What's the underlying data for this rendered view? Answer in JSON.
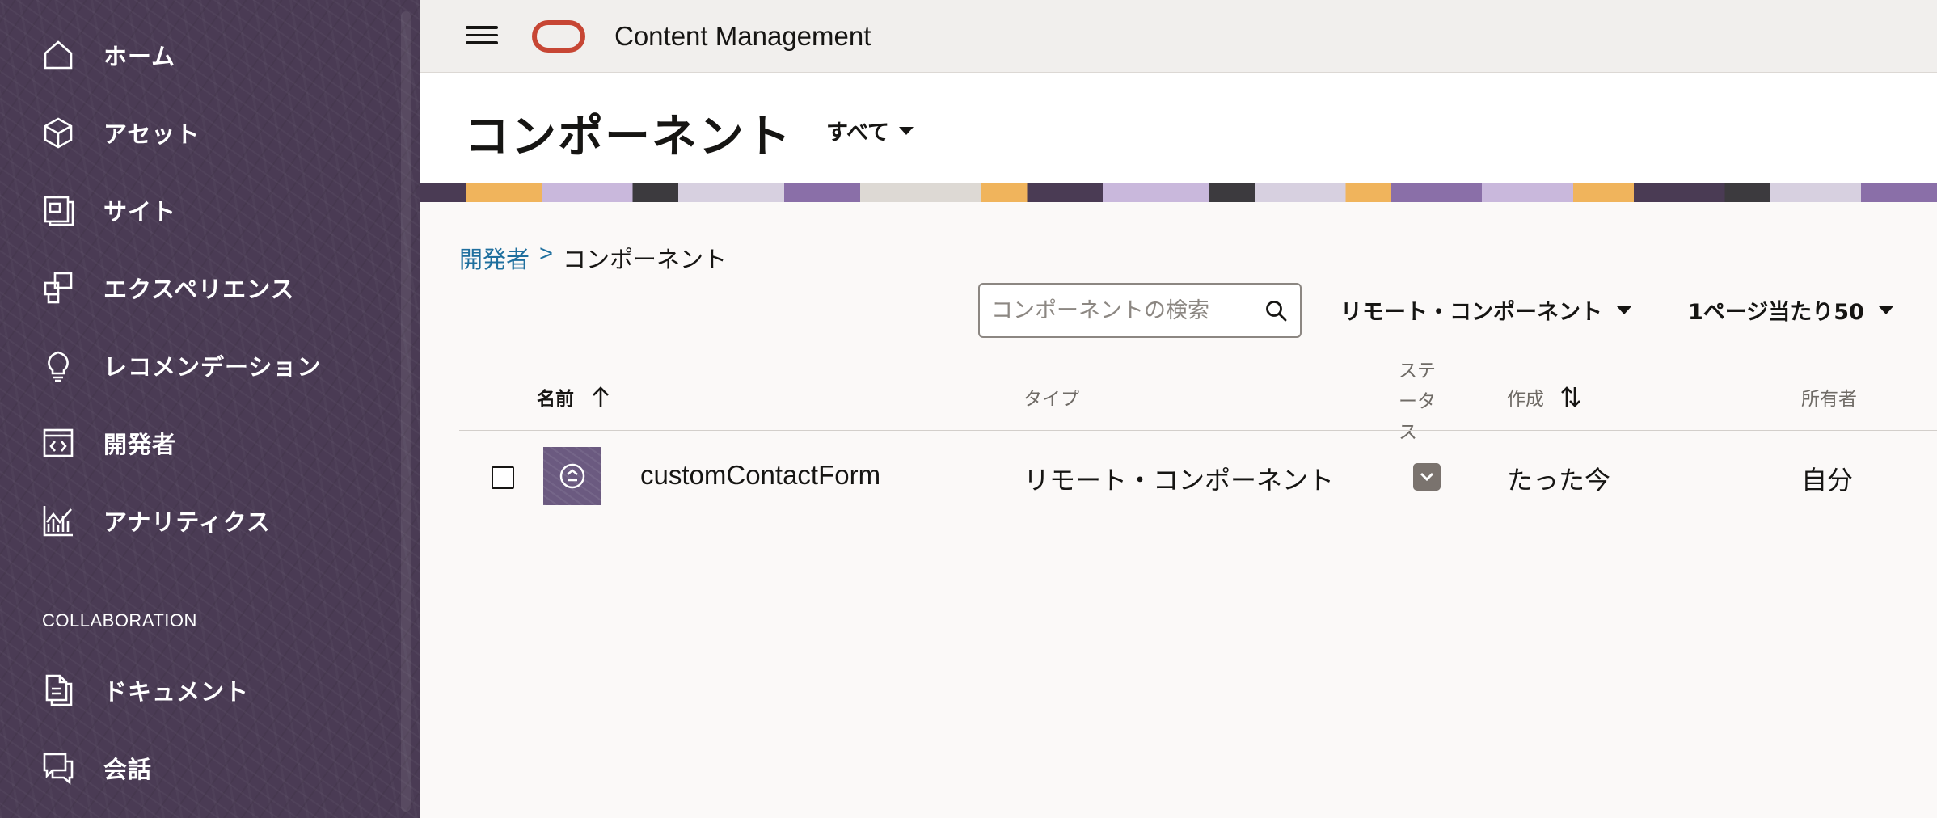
{
  "sidebar": {
    "items": [
      {
        "label": "ホーム",
        "icon": "home-icon"
      },
      {
        "label": "アセット",
        "icon": "cube-icon"
      },
      {
        "label": "サイト",
        "icon": "site-icon"
      },
      {
        "label": "エクスペリエンス",
        "icon": "experience-icon"
      },
      {
        "label": "レコメンデーション",
        "icon": "lightbulb-icon"
      },
      {
        "label": "開発者",
        "icon": "code-icon"
      },
      {
        "label": "アナリティクス",
        "icon": "analytics-icon"
      }
    ],
    "section_label": "COLLABORATION",
    "collab_items": [
      {
        "label": "ドキュメント",
        "icon": "document-icon"
      },
      {
        "label": "会話",
        "icon": "chat-icon"
      }
    ]
  },
  "header": {
    "app_title": "Content Management",
    "brand_color": "#c74634"
  },
  "page": {
    "title": "コンポーネント",
    "filter": "すべて"
  },
  "breadcrumb": {
    "parent": "開発者",
    "separator": ">",
    "current": "コンポーネント"
  },
  "toolbar": {
    "search_placeholder": "コンポーネントの検索",
    "type_filter": "リモート・コンポーネント",
    "page_size": "1ページ当たり50"
  },
  "table": {
    "columns": {
      "name": "名前",
      "type": "タイプ",
      "status": "ステータス",
      "created": "作成",
      "owner": "所有者"
    },
    "rows": [
      {
        "name": "customContactForm",
        "type": "リモート・コンポーネント",
        "created": "たった今",
        "owner": "自分"
      }
    ]
  }
}
